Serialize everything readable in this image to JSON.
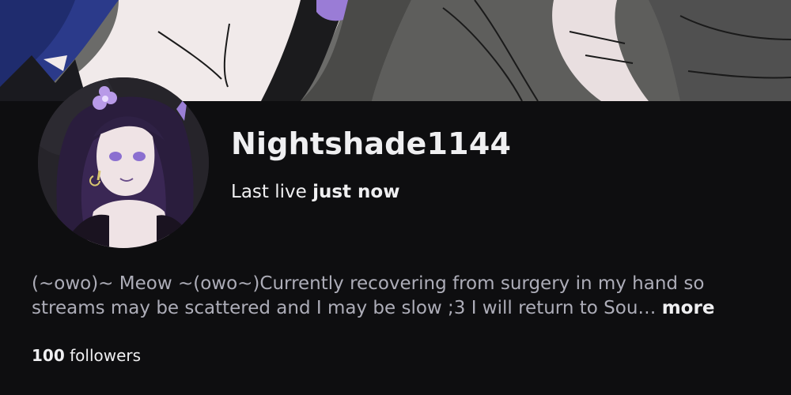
{
  "channel": {
    "name": "Nightshade1144",
    "last_live_prefix": "Last live",
    "last_live_value": "just now"
  },
  "bio": {
    "line1": "(~owo)~ Meow ~(owo~)Currently recovering from surgery in my hand so",
    "line2": "streams may be scattered and I may be slow ;3 I will return to Sou…",
    "more_label": "more"
  },
  "stats": {
    "followers_count": "100",
    "followers_label": "followers"
  },
  "colors": {
    "background": "#0e0e10",
    "text_primary": "#efeff1",
    "text_secondary": "#adadb8",
    "accent": "#9b7fd6"
  },
  "images": {
    "banner": "channel-banner-artwork",
    "avatar": "channel-avatar-artwork"
  }
}
